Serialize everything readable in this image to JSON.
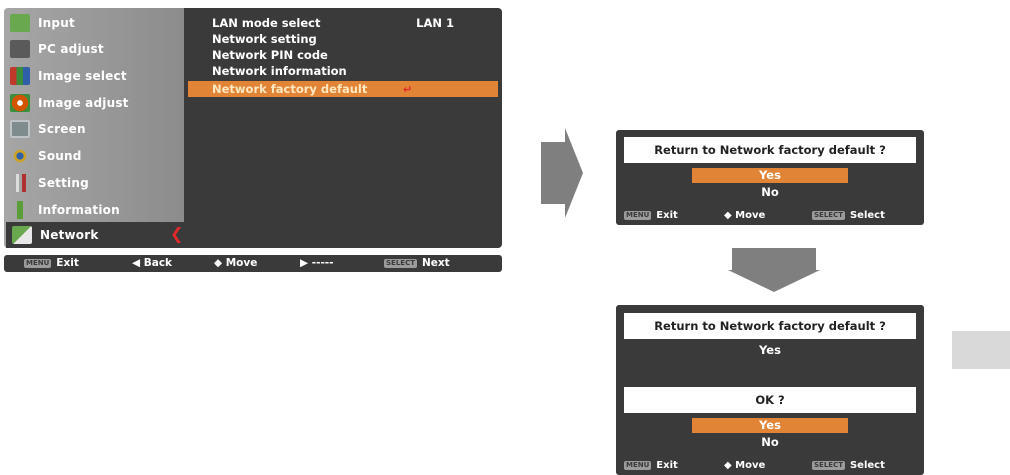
{
  "sidebar": {
    "items": [
      {
        "label": "Input",
        "icon": "input-icon",
        "color": "#6aa84f"
      },
      {
        "label": "PC adjust",
        "icon": "pc-adjust-icon",
        "color": "#5a5a5a"
      },
      {
        "label": "Image select",
        "icon": "image-select-icon",
        "color": "#c0392b"
      },
      {
        "label": "Image adjust",
        "icon": "image-adjust-icon",
        "color": "#d35400"
      },
      {
        "label": "Screen",
        "icon": "screen-icon",
        "color": "#7f8c8d"
      },
      {
        "label": "Sound",
        "icon": "sound-icon",
        "color": "#c9a227"
      },
      {
        "label": "Setting",
        "icon": "setting-icon",
        "color": "#b03030"
      },
      {
        "label": "Information",
        "icon": "information-icon",
        "color": "#5a9e3a"
      },
      {
        "label": "Network",
        "icon": "network-icon",
        "color": "#6aa84f"
      }
    ],
    "selected": "Network"
  },
  "network_menu": {
    "items": [
      {
        "label": "LAN mode select",
        "value": "LAN 1"
      },
      {
        "label": "Network setting"
      },
      {
        "label": "Network PIN code"
      },
      {
        "label": "Network information"
      },
      {
        "label": "Network factory default"
      }
    ],
    "highlighted": "Network factory default"
  },
  "bottom_bar": {
    "menu_key": "MENU",
    "exit": "Exit",
    "back": "◀ Back",
    "move": "◆ Move",
    "right": "▶ -----",
    "select_key": "SELECT",
    "next": "Next"
  },
  "dialog1": {
    "question": "Return to Network factory default ?",
    "yes": "Yes",
    "no": "No",
    "footer": {
      "menu_key": "MENU",
      "exit": "Exit",
      "move": "◆ Move",
      "select_key": "SELECT",
      "select": "Select"
    }
  },
  "dialog2": {
    "question": "Return to Network factory default ?",
    "chosen": "Yes",
    "confirm": "OK ?",
    "yes": "Yes",
    "no": "No",
    "footer": {
      "menu_key": "MENU",
      "exit": "Exit",
      "move": "◆ Move",
      "select_key": "SELECT",
      "select": "Select"
    }
  },
  "colors": {
    "osd_background": "#3a3a3a",
    "sidebar_background": "#999999",
    "highlight": "#e28436",
    "arrow_gray": "#7f7f7f",
    "marker_red": "#e02a2a"
  }
}
